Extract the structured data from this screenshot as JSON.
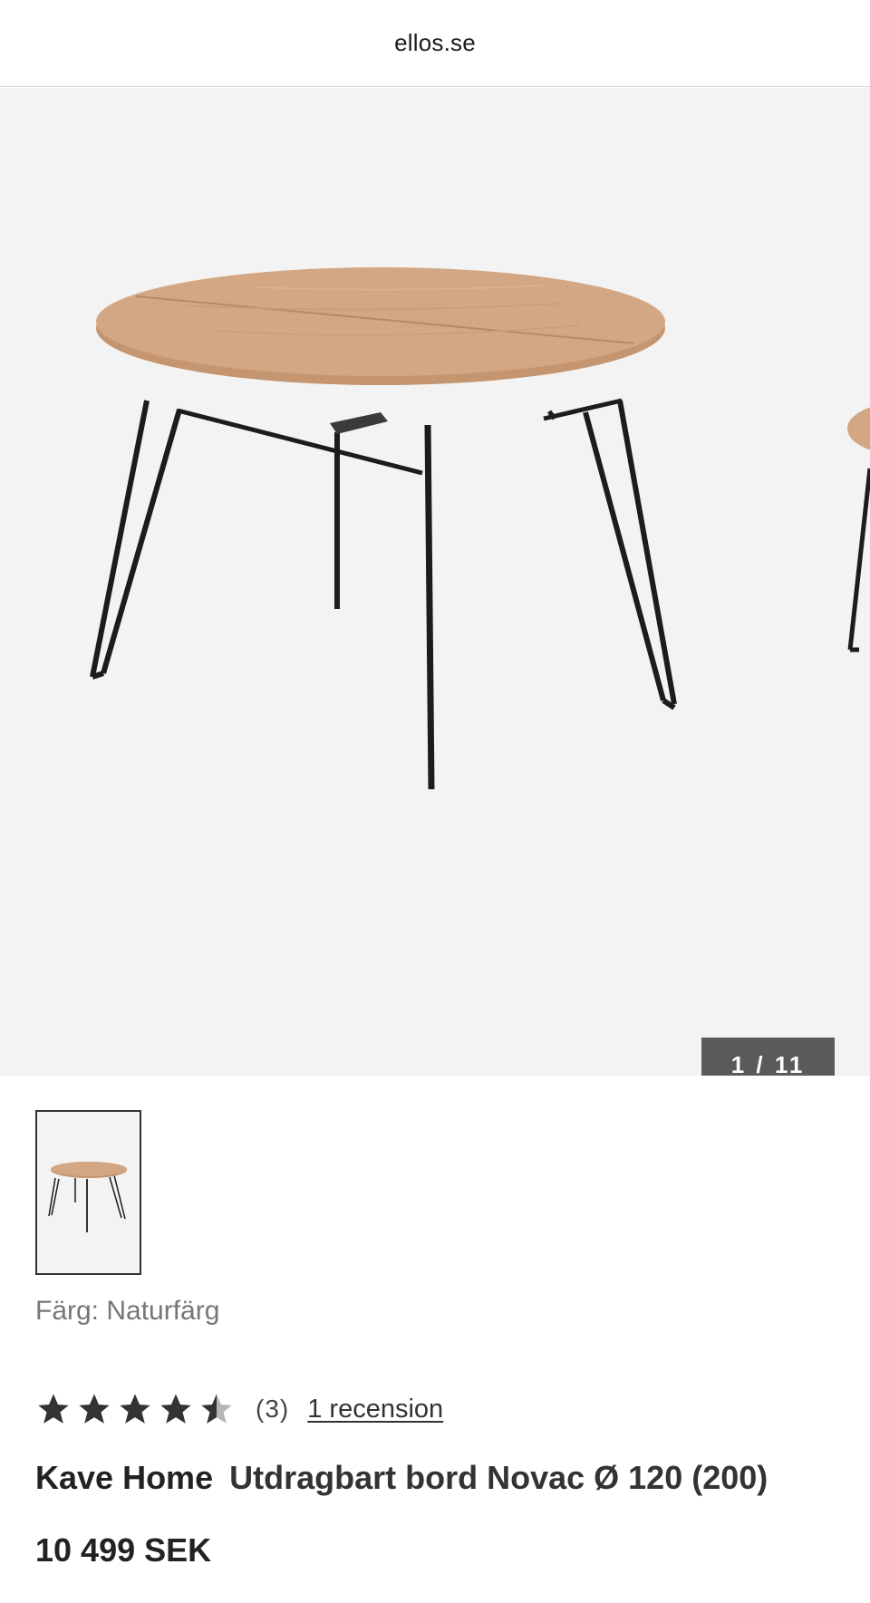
{
  "browser": {
    "url": "ellos.se"
  },
  "gallery": {
    "counter": "1 / 11",
    "main_image": "round-extendable-table-photo",
    "thumbnail_image": "round-extendable-table-thumbnail"
  },
  "product": {
    "color_label": "Färg: Naturfärg",
    "rating": 4.5,
    "rating_max": 5,
    "rating_count": "(3)",
    "review_link": "1 recension",
    "brand": "Kave Home",
    "name": "Utdragbart bord Novac Ø 120 (200)",
    "price": "10 499 SEK"
  },
  "colors": {
    "tabletop": "#d3a783",
    "legs": "#1c1c1c",
    "counter_bg": "#5a5a5a",
    "star": "#333333",
    "star_empty": "#b5b5b5"
  }
}
